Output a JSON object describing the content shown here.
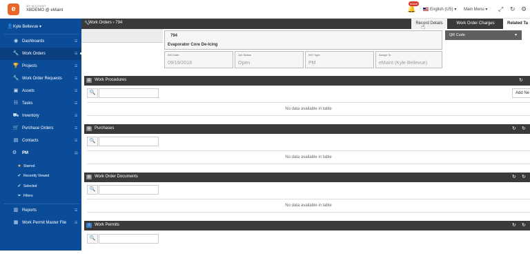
{
  "header": {
    "account_small": "MY ACCOUNT",
    "account_main": "XBDEMO @ eMaint",
    "notification_badge": "90849",
    "language": "English (US)",
    "main_menu": "Main Menu",
    "icons": [
      "bell-icon",
      "expand-icon",
      "refresh-icon",
      "gear-icon"
    ]
  },
  "sidebar": {
    "user": "Kyle Bellevue",
    "items": [
      {
        "label": "Dashboards",
        "icon": "dashboard-icon"
      },
      {
        "label": "Work Orders",
        "icon": "wrench-icon",
        "active": true
      },
      {
        "label": "Projects",
        "icon": "trophy-icon"
      },
      {
        "label": "Work Order Requests",
        "icon": "wrench-icon"
      },
      {
        "label": "Assets",
        "icon": "cubes-icon"
      },
      {
        "label": "Tasks",
        "icon": "tasks-icon"
      },
      {
        "label": "Inventory",
        "icon": "truck-icon"
      },
      {
        "label": "Purchase Orders",
        "icon": "cart-icon"
      },
      {
        "label": "Contacts",
        "icon": "address-icon"
      },
      {
        "label": "PM",
        "icon": "gears-icon"
      }
    ],
    "pm_sub": [
      {
        "label": "Starred",
        "icon": "star-icon"
      },
      {
        "label": "Recently Viewed",
        "icon": "check-icon"
      },
      {
        "label": "Selected",
        "icon": "check-icon"
      },
      {
        "label": "Filters",
        "icon": "filter-icon"
      }
    ],
    "bottom": [
      {
        "label": "Reports",
        "icon": "bar-chart-icon"
      },
      {
        "label": "Work Permit Master File",
        "icon": "table-icon"
      }
    ]
  },
  "main": {
    "breadcrumb": "Work Orders › 794",
    "tabs": [
      "Record Details",
      "Work Order Charges",
      "Related Ta"
    ],
    "work_order_number": "794",
    "work_order_description": "Evaporator Core De-Icing",
    "fields": [
      {
        "label": "WO Date",
        "value": "09/19/2018"
      },
      {
        "label": "Job Status",
        "value": "Open"
      },
      {
        "label": "WO Type",
        "value": "PM"
      },
      {
        "label": "Assign To",
        "value": "eMaint (Kyle Bellevue)"
      }
    ],
    "qr_button": "QR Code",
    "sections": [
      {
        "title": "Work Procedures",
        "empty": "No data available in table",
        "add_label": "Add Ne"
      },
      {
        "title": "Purchases",
        "empty": "No data available in table"
      },
      {
        "title": "Work Order Documents",
        "empty": "No data available in table"
      },
      {
        "title": "Work Permits",
        "empty": ""
      }
    ]
  }
}
